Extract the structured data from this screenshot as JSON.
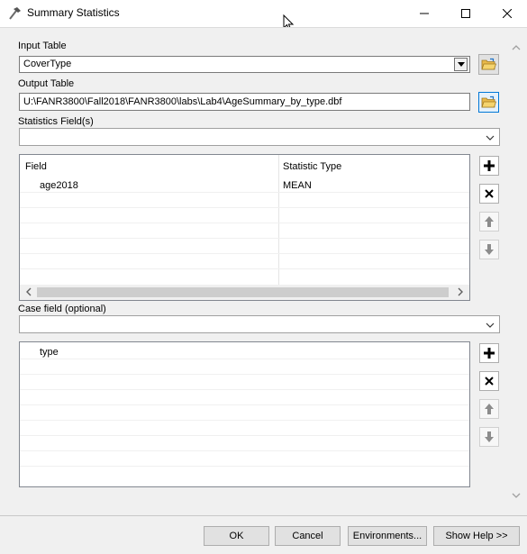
{
  "window": {
    "title": "Summary Statistics",
    "title_icon": "hammer-icon",
    "controls": [
      "minimize-icon",
      "maximize-icon",
      "close-icon"
    ]
  },
  "form": {
    "input_table": {
      "label": "Input Table",
      "value": "CoverType"
    },
    "output_table": {
      "label": "Output Table",
      "value": "U:\\FANR3800\\Fall2018\\FANR3800\\labs\\Lab4\\AgeSummary_by_type.dbf"
    },
    "statistics_fields": {
      "label": "Statistics Field(s)",
      "value": "",
      "columns": [
        "Field",
        "Statistic Type"
      ],
      "rows": [
        {
          "field": "age2018",
          "stat": "MEAN"
        }
      ]
    },
    "case_field": {
      "label": "Case field (optional)",
      "value": "",
      "rows": [
        "type"
      ]
    }
  },
  "buttons": {
    "ok": "OK",
    "cancel": "Cancel",
    "environments": "Environments...",
    "show_help": "Show Help >>"
  },
  "colors": {
    "add": "#000000",
    "remove": "#000000",
    "arrow_disabled": "#8c8c8c",
    "folder_yellow": "#e8b94a"
  }
}
